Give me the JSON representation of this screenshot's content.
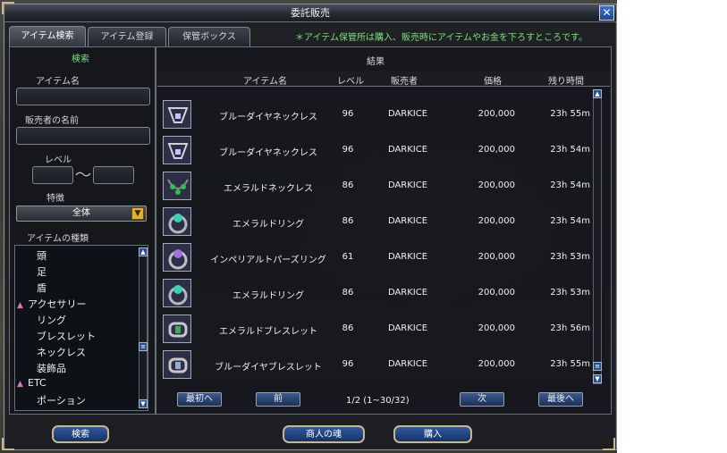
{
  "window": {
    "title": "委託販売",
    "close_label": "✕"
  },
  "tabs": [
    {
      "label": "アイテム検索",
      "active": true
    },
    {
      "label": "アイテム登録",
      "active": false
    },
    {
      "label": "保管ボックス",
      "active": false
    }
  ],
  "notice": "＊アイテム保管所は購入、販売時にアイテムやお金を下ろすところです。",
  "search": {
    "header": "検索",
    "item_name_label": "アイテム名",
    "item_name_value": "",
    "seller_label": "販売者の名前",
    "seller_value": "",
    "level_label": "レベル",
    "level_min": "",
    "level_max": "",
    "special_label": "特徴",
    "special_value": "全体",
    "types_label": "アイテムの種類",
    "types": [
      {
        "label": "頭",
        "category": false
      },
      {
        "label": "足",
        "category": false
      },
      {
        "label": "盾",
        "category": false
      },
      {
        "label": "アクセサリー",
        "category": true
      },
      {
        "label": "リング",
        "category": false
      },
      {
        "label": "ブレスレット",
        "category": false
      },
      {
        "label": "ネックレス",
        "category": false
      },
      {
        "label": "装飾品",
        "category": false
      },
      {
        "label": "ETC",
        "category": true
      },
      {
        "label": "ポーション",
        "category": false
      }
    ],
    "search_button": "検索"
  },
  "results": {
    "header": "結果",
    "columns": {
      "name": "アイテム名",
      "level": "レベル",
      "seller": "販売者",
      "price": "価格",
      "time": "残り時間"
    },
    "rows": [
      {
        "name": "ブルーダイヤネックレス",
        "level": "96",
        "seller": "DARKICE",
        "price": "200,000",
        "time": "23h 55m",
        "icon": "blue-diamond-necklace-icon",
        "color": "#8a8ab0"
      },
      {
        "name": "ブルーダイヤネックレス",
        "level": "96",
        "seller": "DARKICE",
        "price": "200,000",
        "time": "23h 54m",
        "icon": "blue-diamond-necklace-icon",
        "color": "#8a8ab0"
      },
      {
        "name": "エメラルドネックレス",
        "level": "86",
        "seller": "DARKICE",
        "price": "200,000",
        "time": "23h 54m",
        "icon": "emerald-necklace-icon",
        "color": "#2fa84a"
      },
      {
        "name": "エメラルドリング",
        "level": "86",
        "seller": "DARKICE",
        "price": "200,000",
        "time": "23h 54m",
        "icon": "emerald-ring-icon",
        "color": "#3fb8a0"
      },
      {
        "name": "インペリアルトパーズリング",
        "level": "61",
        "seller": "DARKICE",
        "price": "200,000",
        "time": "23h 53m",
        "icon": "imperial-topaz-ring-icon",
        "color": "#9a70c8"
      },
      {
        "name": "エメラルドリング",
        "level": "86",
        "seller": "DARKICE",
        "price": "200,000",
        "time": "23h 53m",
        "icon": "emerald-ring-icon",
        "color": "#3fb8a0"
      },
      {
        "name": "エメラルドブレスレット",
        "level": "86",
        "seller": "DARKICE",
        "price": "200,000",
        "time": "23h 56m",
        "icon": "emerald-bracelet-icon",
        "color": "#a0a8a0"
      },
      {
        "name": "ブルーダイヤブレスレット",
        "level": "96",
        "seller": "DARKICE",
        "price": "200,000",
        "time": "23h 55m",
        "icon": "blue-diamond-bracelet-icon",
        "color": "#9098a8"
      }
    ],
    "pager": {
      "first": "最初へ",
      "prev": "前",
      "page": "1/2 (1~30/32)",
      "next": "次",
      "last": "最後へ"
    }
  },
  "bottom": {
    "merchant_soul": "商人の魂",
    "buy": "購入"
  }
}
